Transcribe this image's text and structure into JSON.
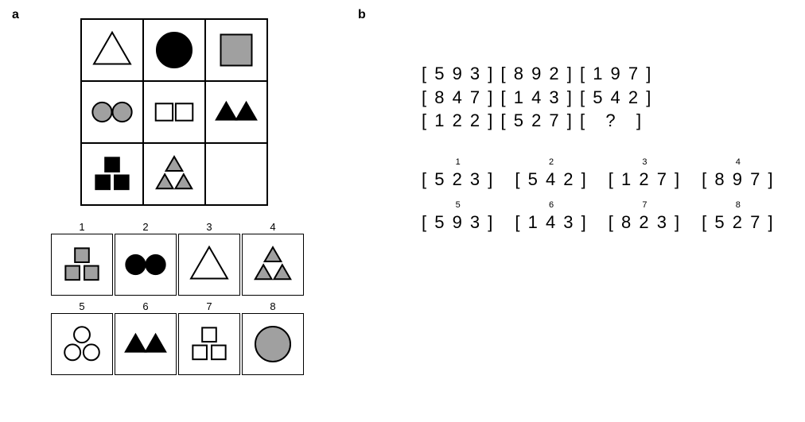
{
  "labels": {
    "a": "a",
    "b": "b"
  },
  "panel_a": {
    "matrix": [
      [
        {
          "shape": "triangle",
          "fill": "none",
          "count": 1
        },
        {
          "shape": "circle",
          "fill": "black",
          "count": 1
        },
        {
          "shape": "square",
          "fill": "gray",
          "count": 1
        }
      ],
      [
        {
          "shape": "circle",
          "fill": "gray",
          "count": 2
        },
        {
          "shape": "square",
          "fill": "none",
          "count": 2
        },
        {
          "shape": "triangle",
          "fill": "black",
          "count": 2
        }
      ],
      [
        {
          "shape": "square",
          "fill": "black",
          "count": 3
        },
        {
          "shape": "triangle",
          "fill": "gray",
          "count": 3
        },
        {
          "shape": null
        }
      ]
    ],
    "options": [
      {
        "n": "1",
        "shape": "square",
        "fill": "gray",
        "count": 3
      },
      {
        "n": "2",
        "shape": "circle",
        "fill": "black",
        "count": 2
      },
      {
        "n": "3",
        "shape": "triangle",
        "fill": "none",
        "count": 1
      },
      {
        "n": "4",
        "shape": "triangle",
        "fill": "gray",
        "count": 3
      },
      {
        "n": "5",
        "shape": "circle",
        "fill": "none",
        "count": 3
      },
      {
        "n": "6",
        "shape": "triangle",
        "fill": "black",
        "count": 2
      },
      {
        "n": "7",
        "shape": "square",
        "fill": "none",
        "count": 3
      },
      {
        "n": "8",
        "shape": "circle",
        "fill": "gray",
        "count": 1
      }
    ]
  },
  "panel_b": {
    "matrix": [
      [
        "[ 5 9 3 ]",
        "[ 8 9 2 ]",
        "[ 1 9 7 ]"
      ],
      [
        "[ 8 4 7 ]",
        "[ 1 4 3 ]",
        "[ 5 4 2 ]"
      ],
      [
        "[ 1 2 2 ]",
        "[ 5 2 7 ]",
        "[   ?   ]"
      ]
    ],
    "options": [
      {
        "n": "1",
        "text": "[ 5 2 3 ]"
      },
      {
        "n": "2",
        "text": "[ 5 4 2 ]"
      },
      {
        "n": "3",
        "text": "[ 1 2 7 ]"
      },
      {
        "n": "4",
        "text": "[ 8 9 7 ]"
      },
      {
        "n": "5",
        "text": "[ 5 9 3 ]"
      },
      {
        "n": "6",
        "text": "[ 1 4 3 ]"
      },
      {
        "n": "7",
        "text": "[ 8 2 3 ]"
      },
      {
        "n": "8",
        "text": "[ 5 2 7 ]"
      }
    ]
  }
}
